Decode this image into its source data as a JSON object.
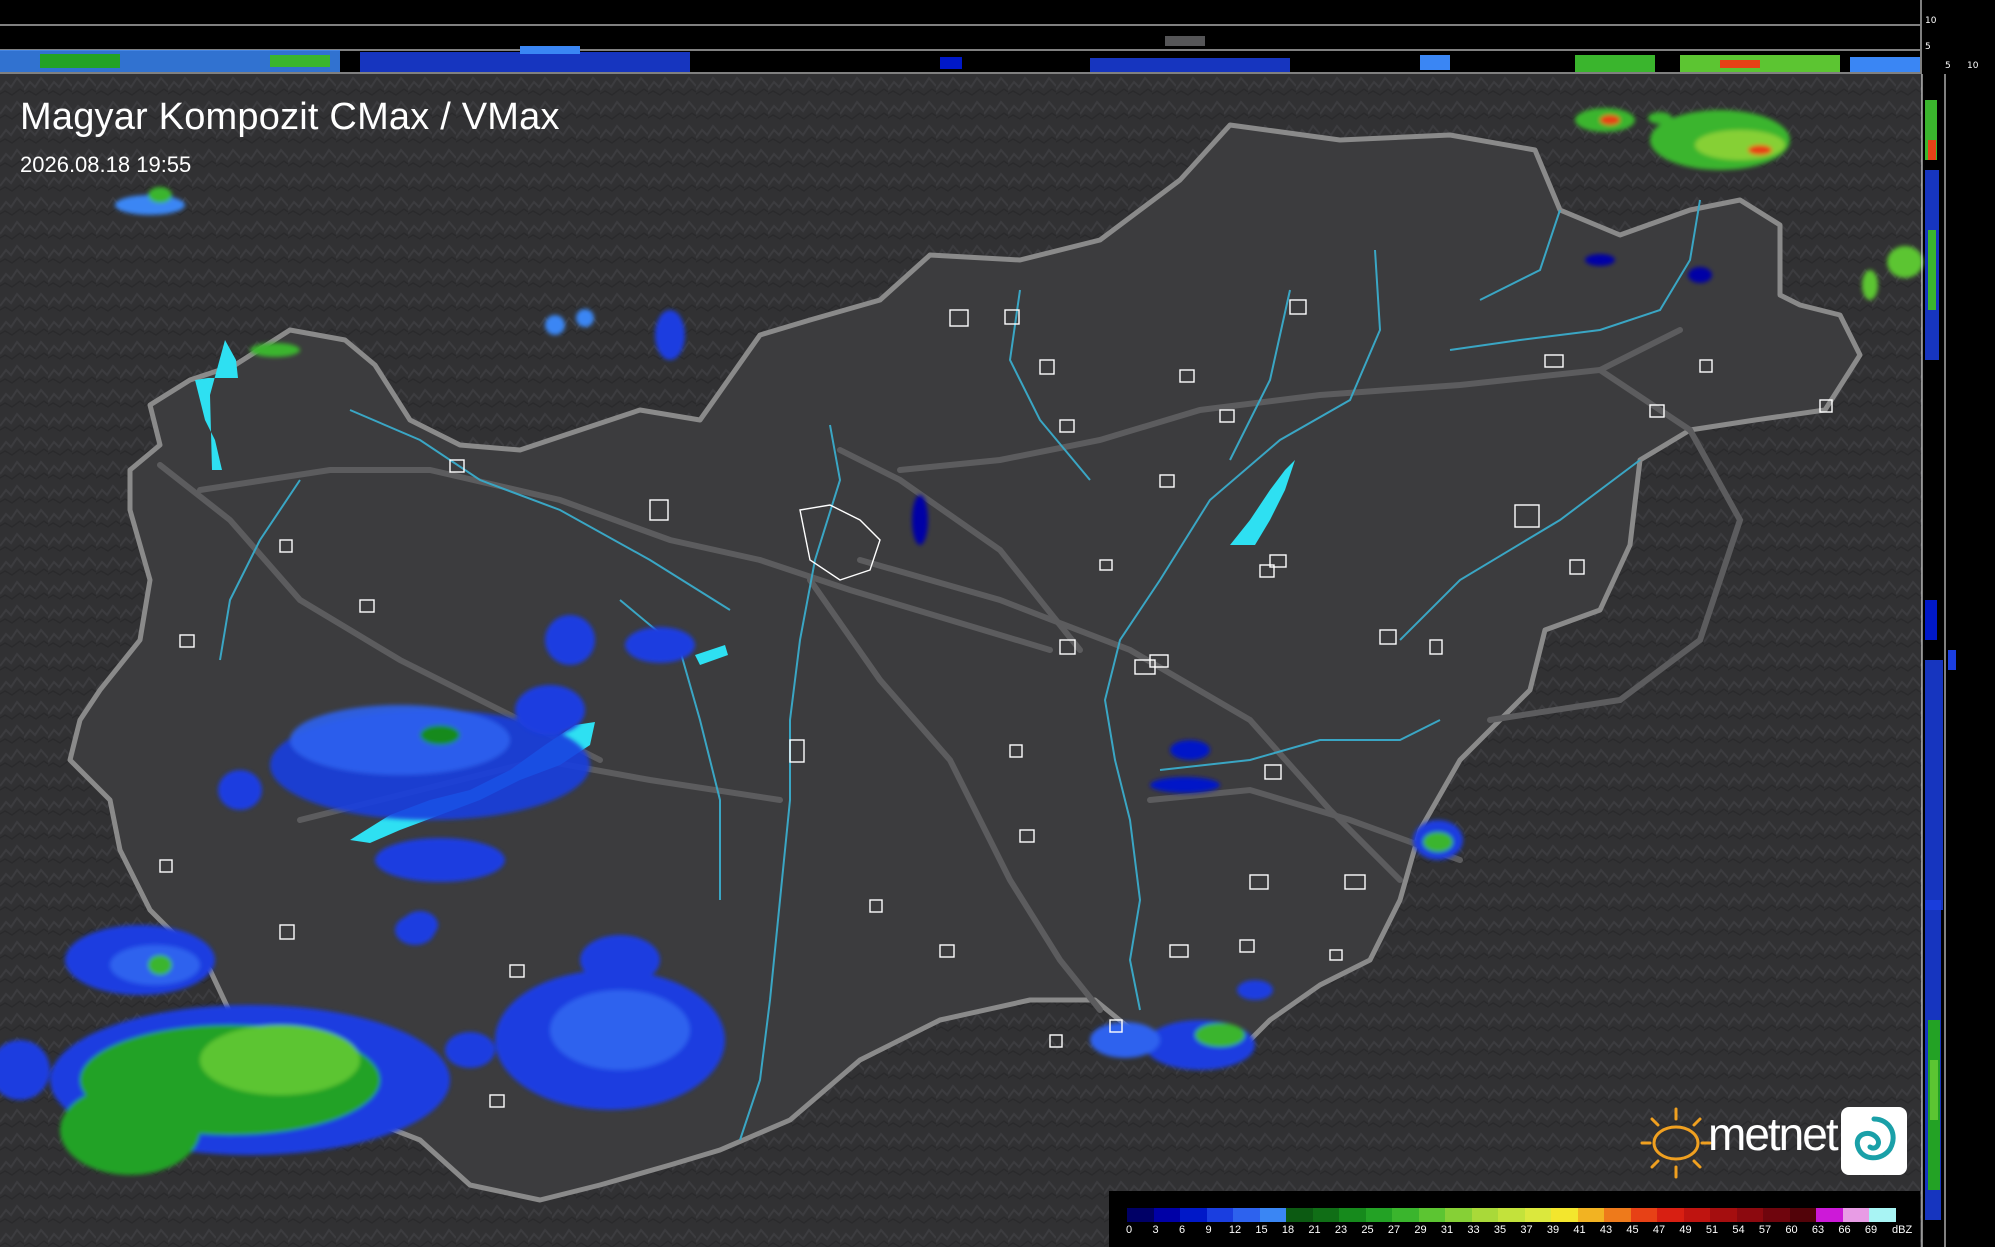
{
  "header": {
    "title": "Magyar Kompozit CMax / VMax",
    "timestamp": "2026.08.18 19:55"
  },
  "profile_ticks": {
    "top_right": [
      "10",
      "5"
    ],
    "right_top": [
      "5",
      "10"
    ]
  },
  "logo": {
    "brand": "metnet",
    "icons": [
      "sun-icon",
      "swirl-icon"
    ]
  },
  "legend": {
    "unit": "dBZ",
    "labels": [
      "0",
      "3",
      "6",
      "9",
      "12",
      "15",
      "18",
      "21",
      "23",
      "25",
      "27",
      "29",
      "31",
      "33",
      "35",
      "37",
      "39",
      "41",
      "43",
      "45",
      "47",
      "49",
      "51",
      "54",
      "57",
      "60",
      "63",
      "66",
      "69"
    ],
    "colors": [
      "#000066",
      "#0000a6",
      "#0018c8",
      "#1a3ee0",
      "#2d62ee",
      "#3a86f4",
      "#0c5a12",
      "#106e16",
      "#168a1c",
      "#23a225",
      "#3ab52d",
      "#5cc532",
      "#86d036",
      "#a9d939",
      "#c3e23b",
      "#dbe83d",
      "#f3e62d",
      "#f2b322",
      "#ee7a1b",
      "#e74116",
      "#d81f12",
      "#bf1410",
      "#a50e0f",
      "#8c090f",
      "#6f050d",
      "#520309",
      "#cd19d8",
      "#e89ce5",
      "#a8f4f4"
    ]
  },
  "colors": {
    "background": "#333335",
    "border": "#8a8a8a",
    "rivers": "#3aa6c4",
    "lakes": "#2ee0f2",
    "cities": "#ffffff"
  }
}
